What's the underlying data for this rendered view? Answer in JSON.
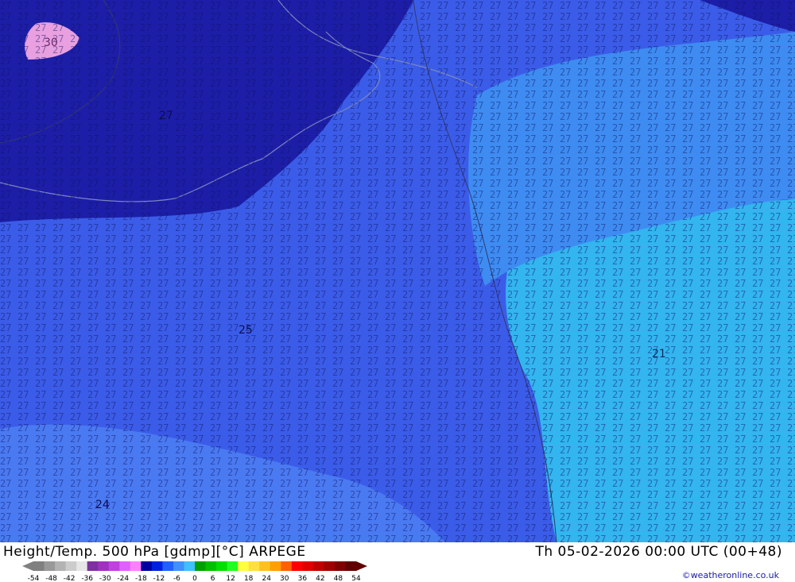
{
  "map": {
    "title": "Height/Temp. 500 hPa [gdmp][°C] ARPEGE",
    "valid_time": "Th 05-02-2026 00:00 UTC (00+48)",
    "credit": "©weatheronline.co.uk",
    "region_labels": {
      "pink": "30",
      "dark": "27",
      "mid": "25",
      "light": "24",
      "cyan": "21"
    }
  },
  "legend": {
    "ticks": [
      "-54",
      "-48",
      "-42",
      "-36",
      "-30",
      "-24",
      "-18",
      "-12",
      "-6",
      "0",
      "6",
      "12",
      "18",
      "24",
      "30",
      "36",
      "42",
      "48",
      "54"
    ],
    "colors": [
      "#808080",
      "#999999",
      "#b3b3b3",
      "#cccccc",
      "#e6e6e6",
      "#7f2f9f",
      "#a030c0",
      "#c040e0",
      "#e060ff",
      "#ff80ff",
      "#0000a0",
      "#0020e0",
      "#2060ff",
      "#4090ff",
      "#40c0ff",
      "#00a000",
      "#00c000",
      "#00e000",
      "#20ff20",
      "#ffff40",
      "#ffe040",
      "#ffc020",
      "#ffa000",
      "#ff6000",
      "#ff0000",
      "#e00000",
      "#c00000",
      "#a00000",
      "#800000",
      "#600000"
    ]
  }
}
